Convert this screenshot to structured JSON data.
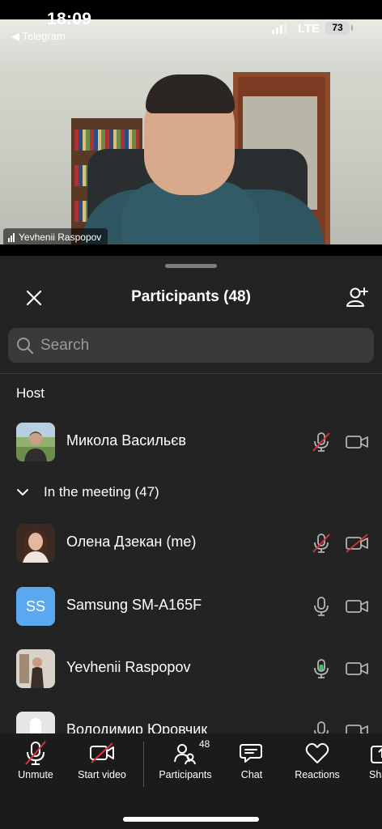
{
  "status_bar": {
    "time": "18:09",
    "back_app": "◀ Telegram",
    "network": "LTE",
    "battery": "73"
  },
  "video": {
    "speaker_name": "Yevhenii Raspopov"
  },
  "sheet": {
    "title": "Participants (48)",
    "search_placeholder": "Search",
    "host_section": "Host",
    "group_label": "In the meeting (47)"
  },
  "host": {
    "name": "Микола Васильєв",
    "mic": "muted",
    "camera": "on"
  },
  "participants": [
    {
      "name": "Олена Дзекан (me)",
      "avatar": "photo",
      "mic": "muted",
      "camera": "off"
    },
    {
      "name": "Samsung SM-A165F",
      "avatar_initials": "SS",
      "avatar_color": "#5aa9f0",
      "mic": "on",
      "camera": "on"
    },
    {
      "name": "Yevhenii Raspopov",
      "avatar": "photo",
      "mic": "speaking",
      "camera": "on"
    },
    {
      "name": "Володимир Юровчик",
      "avatar": "placeholder",
      "mic": "on",
      "camera": "on"
    }
  ],
  "toolbar": {
    "unmute": "Unmute",
    "start_video": "Start video",
    "participants": "Participants",
    "participants_count": "48",
    "chat": "Chat",
    "reactions": "Reactions",
    "share": "Share"
  },
  "colors": {
    "sheet_bg": "#232323",
    "muted_red": "#e0323a",
    "speaking_green": "#3cc36b",
    "icon_gray": "#b5b5b5"
  }
}
